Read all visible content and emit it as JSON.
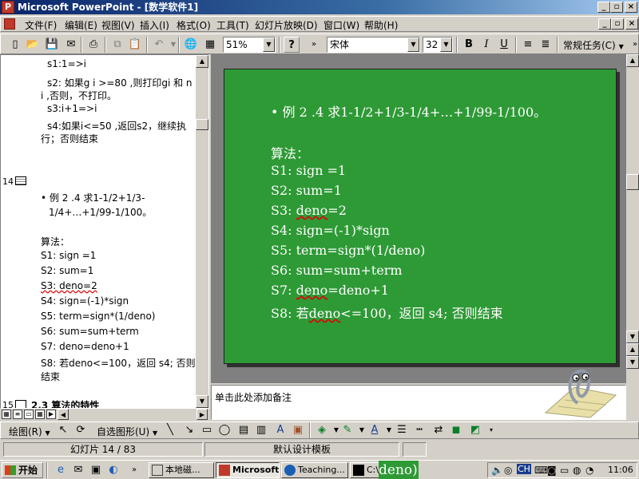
{
  "window": {
    "title": "Microsoft PowerPoint - [数学软件1]",
    "minimize": "_",
    "restore": "▫",
    "close": "×"
  },
  "menu": {
    "items": [
      "文件(F)",
      "编辑(E)",
      "视图(V)",
      "插入(I)",
      "格式(O)",
      "工具(T)",
      "幻灯片放映(D)",
      "窗口(W)",
      "帮助(H)"
    ]
  },
  "toolbar": {
    "zoom": "51%",
    "font": "宋体",
    "font_size": "32",
    "bold": "B",
    "italic": "I",
    "underline": "U",
    "tasks": "常规任务(C)",
    "help": "?"
  },
  "outline": {
    "prev_lines": [
      "s1:1=>i",
      "s2: 如果g i >=80 ,则打印gi 和 n",
      "i ,否则，不打印。",
      "s3:i+1=>i",
      "s4:如果i<=50 ,返回s2，继续执",
      "行；否则结束"
    ],
    "slide14_num": "14",
    "bullet1": "• 例 2 .4  求1-1/2+1/3-",
    "bullet2": "1/4+…+1/99-1/100。",
    "algo_title": "算法：",
    "steps": [
      "S1: sign =1",
      "S2: sum=1",
      "S3: deno=2",
      "S4: sign=(-1)*sign",
      "S5: term=sign*(1/deno)",
      "S6: sum=sum+term",
      "S7: deno=deno+1",
      "S8: 若deno<=100，返回 s4; 否则",
      "结束"
    ],
    "slide15_num": "15",
    "slide15_title": "2.3 算法的特性"
  },
  "slide": {
    "bullet": "•  例 2 .4   求1-1/2+1/3-1/4+…+1/99-1/100。",
    "algo_title": "算法：",
    "s1": "S1: sign =1",
    "s2": "S2: sum=1",
    "s3_pre": "S3: ",
    "s3_word": "deno",
    "s3_post": "=2",
    "s4": "S4: sign=(-1)*sign",
    "s5": "S5: term=sign*(1/deno)",
    "s6": "S6: sum=sum+term",
    "s7_pre": "S7: ",
    "s7_word": "deno",
    "s7_post": "=deno+1",
    "s8_pre": "S8: 若",
    "s8_word": "deno",
    "s8_post": "<=100，返回 s4; 否则结束",
    "bg_color": "#2e9a36"
  },
  "notes": {
    "placeholder": "单击此处添加备注"
  },
  "drawing": {
    "draw": "绘图(R)",
    "autoshapes": "自选图形(U)"
  },
  "status": {
    "slide_pos": "幻灯片 14 / 83",
    "template": "默认设计模板"
  },
  "taskbar": {
    "start": "开始",
    "tasks": [
      "本地磁...",
      "Microsoft...",
      "Teaching...",
      "C:\\"
    ],
    "overlay": "deno)",
    "clock": "11:06",
    "lang": "CH"
  }
}
